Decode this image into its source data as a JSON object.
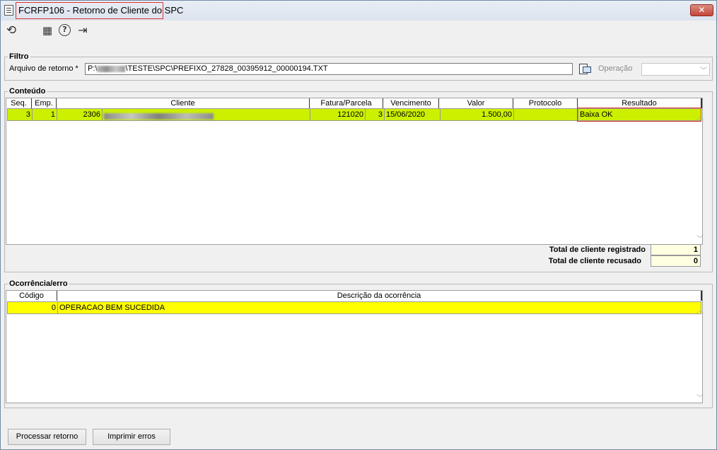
{
  "window": {
    "title": "FCRFP106 - Retorno de Cliente do SPC",
    "close_glyph": "✕",
    "icon": "document-icon"
  },
  "toolbar": {
    "items": [
      {
        "icon": "refresh-icon",
        "glyph": "⟲"
      },
      {
        "icon": "calendar-icon",
        "glyph": "▦"
      },
      {
        "icon": "help-icon",
        "glyph": "?"
      },
      {
        "icon": "exit-icon",
        "glyph": "⇥"
      }
    ]
  },
  "filtro": {
    "legend": "Filtro",
    "arquivo_label": "Arquivo de retorno *",
    "arquivo_prefix": "P:\\",
    "arquivo_suffix": "\\TESTE\\SPC\\PREFIXO_27828_00395912_00000194.TXT",
    "operacao_label": "Operação",
    "operacao_value": ""
  },
  "conteudo": {
    "legend": "Conteúdo",
    "columns": [
      "Seq.",
      "Emp.",
      "Cliente",
      "Fatura/Parcela",
      "Vencimento",
      "Valor",
      "Protocolo",
      "Resultado"
    ],
    "rows": [
      {
        "seq": "3",
        "emp": "1",
        "cliente_codigo": "2306",
        "fatura": "121020",
        "parcela": "3",
        "vencimento": "15/06/2020",
        "valor": "1.500,00",
        "protocolo": "",
        "resultado": "Baixa OK"
      }
    ],
    "total_registrado_label": "Total de cliente registrado",
    "total_registrado_value": "1",
    "total_recusado_label": "Total de cliente recusado",
    "total_recusado_value": "0"
  },
  "ocorrencia": {
    "legend": "Ocorrência/erro",
    "columns": [
      "Código",
      "Descrição da ocorrência"
    ],
    "rows": [
      {
        "codigo": "0",
        "descricao": "OPERACAO BEM SUCEDIDA"
      }
    ]
  },
  "buttons": {
    "processar": "Processar retorno",
    "imprimir": "Imprimir erros"
  },
  "colors": {
    "row_highlight": "#ccf000",
    "occurrence_highlight": "#ffff00",
    "total_bg": "#ffffe1",
    "annotation_red": "#dd3333"
  }
}
